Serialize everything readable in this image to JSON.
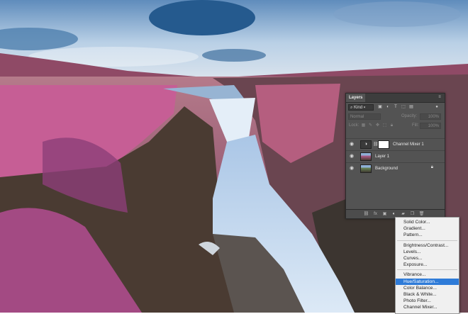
{
  "layers_panel": {
    "tab": "Layers",
    "filter_kind": "Kind",
    "blend_mode": "Normal",
    "opacity_label": "Opacity:",
    "opacity_value": "100%",
    "lock_label": "Lock:",
    "fill_label": "Fill:",
    "fill_value": "100%",
    "layers": [
      {
        "name": "Channel Mixer 1"
      },
      {
        "name": "Layer 1"
      },
      {
        "name": "Background"
      }
    ]
  },
  "adjustment_menu": {
    "items": [
      "Solid Color...",
      "Gradient...",
      "Pattern...",
      "Brightness/Contrast...",
      "Levels...",
      "Curves...",
      "Exposure...",
      "Vibrance...",
      "Hue/Saturation...",
      "Color Balance...",
      "Black & White...",
      "Photo Filter...",
      "Channel Mixer..."
    ],
    "selected": "Hue/Saturation...",
    "highlight_color": "#2e7bd8"
  },
  "colors": {
    "panel_bg": "#535353",
    "sky": "#9fc0de",
    "pink_vegetation": "#c0588f",
    "water": "#c8dcf0"
  }
}
